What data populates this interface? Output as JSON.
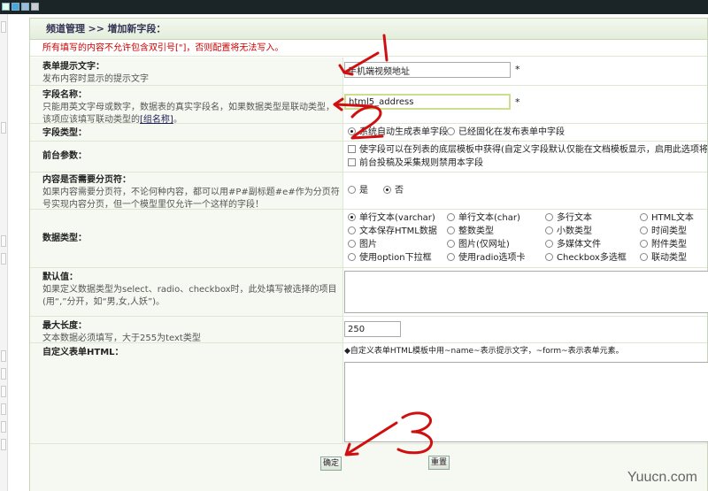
{
  "breadcrumb": {
    "section": "频道管理",
    "separator": ">>",
    "page": "增加新字段："
  },
  "warning": "所有填写的内容不允许包含双引号[\"]，否则配置将无法写入。",
  "fields": {
    "prompt_text": {
      "label": "表单提示文字：",
      "desc": "发布内容时显示的提示文字",
      "value": "手机端视频地址",
      "required": "*"
    },
    "field_name": {
      "label": "字段名称：",
      "desc": "只能用英文字母或数字，数据表的真实字段名，如果数据类型是联动类型，该项应该填写联动类型的",
      "link": "[组名称]",
      "tail": "。",
      "value": "html5_address",
      "required": "*"
    },
    "field_type": {
      "label": "字段类型：",
      "options": [
        "系统自动生成表单字段",
        "已经固化在发布表单中字段"
      ]
    },
    "frontend": {
      "label": "前台参数：",
      "options": [
        "使字段可以在列表的底层模板中获得(自定义字段默认仅能在文档模板显示，启用此选项将使列表查询变",
        "前台投稿及采集规则禁用本字段"
      ]
    },
    "paging": {
      "label": "内容是否需要分页符：",
      "desc": "如果内容需要分页符，不论何种内容，都可以用#P#副标题#e#作为分页符号实现内容分页，但一个模型里仅允许一个这样的字段！",
      "options": [
        "是",
        "否"
      ]
    },
    "data_type": {
      "label": "数据类型：",
      "options": [
        [
          "单行文本(varchar)",
          "单行文本(char)",
          "多行文本",
          "HTML文本"
        ],
        [
          "文本保存HTML数据",
          "整数类型",
          "小数类型",
          "时间类型"
        ],
        [
          "图片",
          "图片(仅网址)",
          "多媒体文件",
          "附件类型"
        ],
        [
          "使用option下拉框",
          "使用radio选项卡",
          "Checkbox多选框",
          "联动类型"
        ]
      ]
    },
    "default_value": {
      "label": "默认值：",
      "desc": "如果定义数据类型为select、radio、checkbox时，此处填写被选择的项目(用“,”分开，如“男,女,人妖”)。"
    },
    "max_length": {
      "label": "最大长度：",
      "desc": "文本数据必须填写，大于255为text类型",
      "value": "250"
    },
    "custom_html": {
      "label": "自定义表单HTML：",
      "hint": "◆自定义表单HTML模板中用~name~表示提示文字，~form~表示表单元素。"
    }
  },
  "buttons": {
    "ok": "确定",
    "reset": "重置"
  },
  "annotations": [
    "1",
    "2",
    "3"
  ],
  "watermark": "Yuucn.com",
  "colors": {
    "annotation": "#d01010",
    "panel_border": "#c5d6b9",
    "label_bg": "#f5f9f1"
  }
}
